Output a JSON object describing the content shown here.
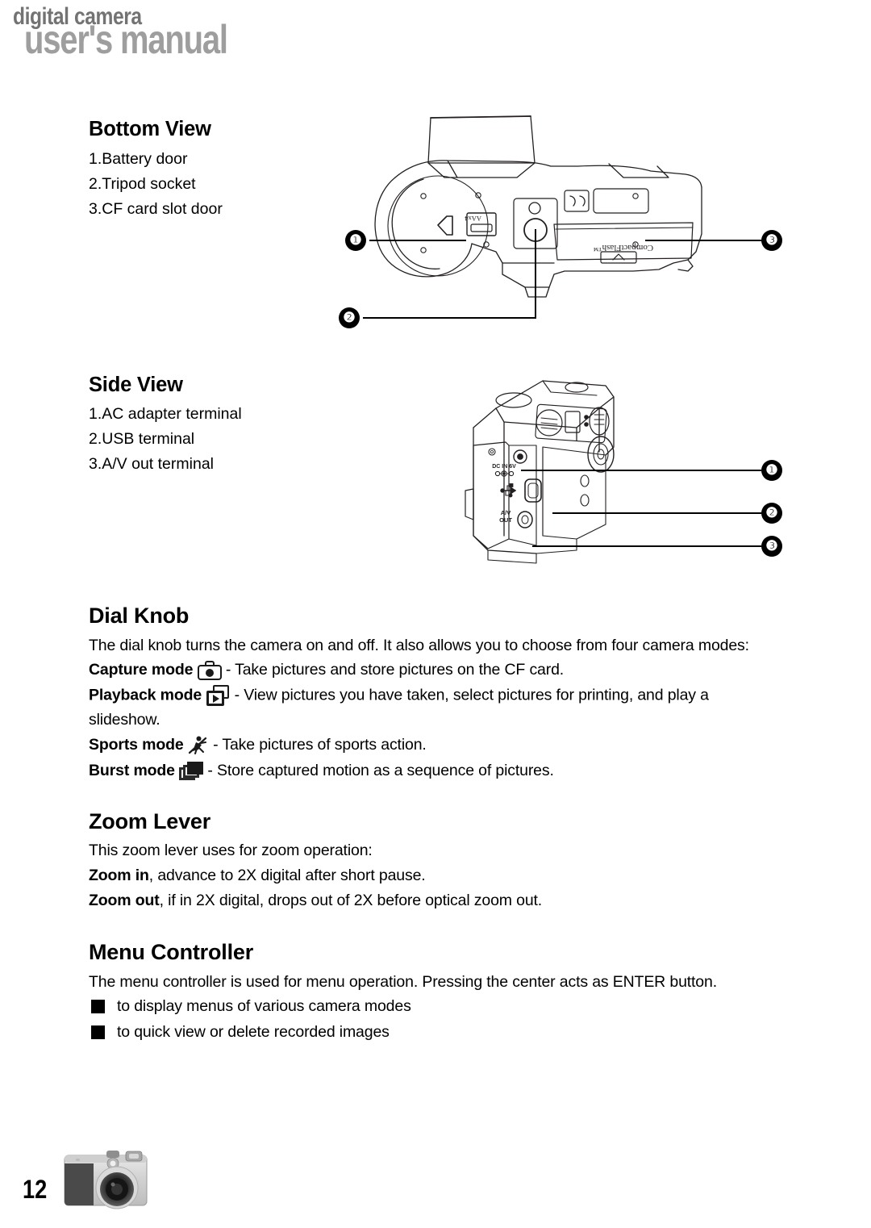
{
  "header": {
    "line1": "digital camera",
    "line2": "user's manual",
    "line1_color": "#737373",
    "line2_color": "#9e9e9e"
  },
  "sections": {
    "bottom_view": {
      "heading": "Bottom View",
      "items": [
        "1.Battery door",
        "2.Tripod socket",
        "3.CF card slot door"
      ],
      "figure": {
        "name": "camera-bottom-diagram",
        "labels": {
          "battery": "AAx4",
          "card": "CompactFlash™"
        },
        "callouts": [
          "❶",
          "❷",
          "❸"
        ]
      }
    },
    "side_view": {
      "heading": "Side View",
      "items": [
        "1.AC adapter terminal",
        "2.USB terminal",
        "3.A/V out terminal"
      ],
      "figure": {
        "name": "camera-side-diagram",
        "labels": {
          "dc_in": "DC IN 6V",
          "usb": "USB",
          "av_out_l1": "A/V",
          "av_out_l2": "OUT"
        },
        "callouts": [
          "❶",
          "❷",
          "❸"
        ]
      }
    },
    "dial_knob": {
      "heading": "Dial Knob",
      "intro": "The dial knob turns the camera on and off. It also allows you to choose from four camera modes:",
      "modes": [
        {
          "label": "Capture mode",
          "icon": "capture-mode-icon",
          "desc": "- Take pictures and store pictures on the CF card."
        },
        {
          "label": "Playback mode",
          "icon": "playback-mode-icon",
          "desc": "- View pictures you have taken, select pictures for printing, and play a",
          "desc_cont": "slideshow."
        },
        {
          "label": "Sports mode",
          "icon": "sports-mode-icon",
          "desc": "- Take pictures of sports action."
        },
        {
          "label": "Burst mode",
          "icon": "burst-mode-icon",
          "desc": "- Store captured motion as a sequence of pictures."
        }
      ]
    },
    "zoom_lever": {
      "heading": "Zoom Lever",
      "intro": "This zoom lever uses for zoom operation:",
      "lines": [
        {
          "bold": "Zoom in",
          "rest": ", advance to 2X digital after short pause."
        },
        {
          "bold": "Zoom out",
          "rest": ", if in 2X digital, drops out of 2X before optical zoom out."
        }
      ]
    },
    "menu_controller": {
      "heading": "Menu Controller",
      "intro": "The menu controller is used for menu operation. Pressing the center acts as ENTER button.",
      "bullets": [
        "to display menus of various camera modes",
        "to quick view or delete recorded images"
      ]
    }
  },
  "footer": {
    "page_number": "12",
    "thumbnail": "camera-photo-thumbnail"
  }
}
